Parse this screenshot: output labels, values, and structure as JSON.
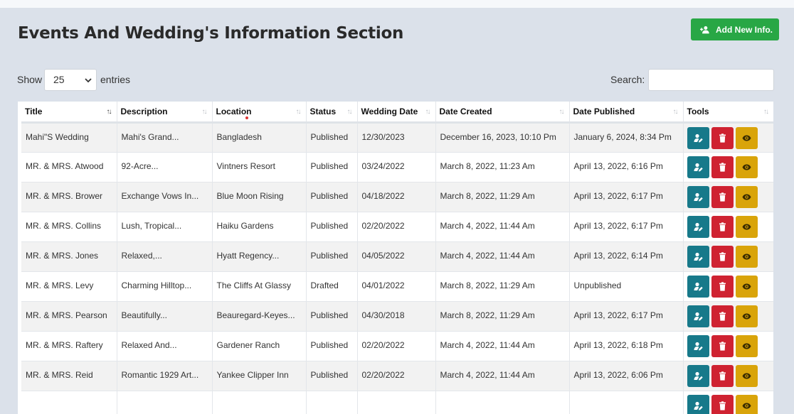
{
  "page": {
    "title": "Events And Wedding's Information Section",
    "add_button_label": "Add New Info."
  },
  "controls": {
    "show_label": "Show",
    "entries_value": "25",
    "entries_label": "entries",
    "search_label": "Search:",
    "search_value": ""
  },
  "columns": [
    "Title",
    "Description",
    "Location",
    "Status",
    "Wedding Date",
    "Date Created",
    "Date Published",
    "Tools"
  ],
  "sort": {
    "column": "Title",
    "direction": "ascending"
  },
  "rows": [
    {
      "title": "Mahi\"S Wedding",
      "description": "Mahi's Grand...",
      "location": "Bangladesh",
      "status": "Published",
      "wedding_date": "12/30/2023",
      "date_created": "December 16, 2023, 10:10 Pm",
      "date_published": "January 6, 2024, 8:34 Pm"
    },
    {
      "title": "MR. & MRS. Atwood",
      "description": "92-Acre...",
      "location": "Vintners Resort",
      "status": "Published",
      "wedding_date": "03/24/2022",
      "date_created": "March 8, 2022, 11:23 Am",
      "date_published": "April 13, 2022, 6:16 Pm"
    },
    {
      "title": "MR. & MRS. Brower",
      "description": "Exchange Vows In...",
      "location": "Blue Moon Rising",
      "status": "Published",
      "wedding_date": "04/18/2022",
      "date_created": "March 8, 2022, 11:29 Am",
      "date_published": "April 13, 2022, 6:17 Pm"
    },
    {
      "title": "MR. & MRS. Collins",
      "description": "Lush, Tropical...",
      "location": "Haiku Gardens",
      "status": "Published",
      "wedding_date": "02/20/2022",
      "date_created": "March 4, 2022, 11:44 Am",
      "date_published": "April 13, 2022, 6:17 Pm"
    },
    {
      "title": "MR. & MRS. Jones",
      "description": "Relaxed,...",
      "location": "Hyatt Regency...",
      "status": "Published",
      "wedding_date": "04/05/2022",
      "date_created": "March 4, 2022, 11:44 Am",
      "date_published": "April 13, 2022, 6:14 Pm"
    },
    {
      "title": "MR. & MRS. Levy",
      "description": "Charming Hilltop...",
      "location": "The Cliffs At Glassy",
      "status": "Drafted",
      "wedding_date": "04/01/2022",
      "date_created": "March 8, 2022, 11:29 Am",
      "date_published": "Unpublished"
    },
    {
      "title": "MR. & MRS. Pearson",
      "description": "Beautifully...",
      "location": "Beauregard-Keyes...",
      "status": "Published",
      "wedding_date": "04/30/2018",
      "date_created": "March 8, 2022, 11:29 Am",
      "date_published": "April 13, 2022, 6:17 Pm"
    },
    {
      "title": "MR. & MRS. Raftery",
      "description": "Relaxed And...",
      "location": "Gardener Ranch",
      "status": "Published",
      "wedding_date": "02/20/2022",
      "date_created": "March 4, 2022, 11:44 Am",
      "date_published": "April 13, 2022, 6:18 Pm"
    },
    {
      "title": "MR. & MRS. Reid",
      "description": "Romantic 1929 Art...",
      "location": "Yankee Clipper Inn",
      "status": "Published",
      "wedding_date": "02/20/2022",
      "date_created": "March 4, 2022, 11:44 Am",
      "date_published": "April 13, 2022, 6:06 Pm"
    },
    {
      "title": "",
      "description": "",
      "location": "",
      "status": "",
      "wedding_date": "",
      "date_created": "",
      "date_published": ""
    }
  ],
  "tools": {
    "icons": [
      "user-edit-icon",
      "trash-icon",
      "eye-icon"
    ],
    "colors": {
      "edit": "#17798a",
      "delete": "#cf2231",
      "view": "#d9a40a"
    }
  },
  "colors": {
    "background": "#dbe1ea",
    "add_button": "#28a745"
  }
}
